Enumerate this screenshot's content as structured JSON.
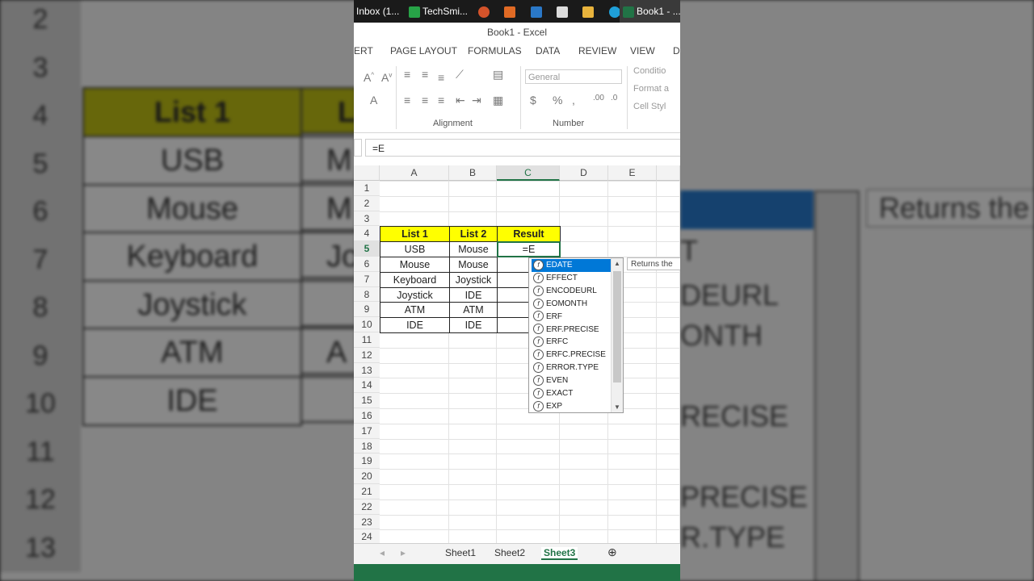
{
  "taskbar": {
    "items": [
      {
        "label": "Inbox (1..."
      },
      {
        "label": "TechSmi..."
      },
      {
        "label": "Book1 - ..."
      }
    ]
  },
  "window": {
    "title": "Book1 - Excel"
  },
  "ribbon_tabs": [
    "ERT",
    "PAGE LAYOUT",
    "FORMULAS",
    "DATA",
    "REVIEW",
    "VIEW",
    "D"
  ],
  "ribbon": {
    "number_format": "General",
    "alignment_label": "Alignment",
    "number_label": "Number",
    "styles": [
      "Conditio",
      "Format a",
      "Cell Styl"
    ]
  },
  "formula_bar": {
    "value": "=E"
  },
  "grid": {
    "columns": [
      "A",
      "B",
      "C",
      "D",
      "E",
      ""
    ],
    "selected_column": "C",
    "rows": [
      "1",
      "2",
      "3",
      "4",
      "5",
      "6",
      "7",
      "8",
      "9",
      "10",
      "11",
      "12",
      "13",
      "14",
      "15",
      "16",
      "17",
      "18",
      "19",
      "20",
      "21",
      "22",
      "23",
      "24"
    ],
    "selected_row": "5",
    "table": {
      "headers": [
        "List 1",
        "List 2",
        "Result"
      ],
      "rows": [
        [
          "USB",
          "Mouse",
          "=E"
        ],
        [
          "Mouse",
          "Mouse",
          ""
        ],
        [
          "Keyboard",
          "Joystick",
          ""
        ],
        [
          "Joystick",
          "IDE",
          ""
        ],
        [
          "ATM",
          "ATM",
          ""
        ],
        [
          "IDE",
          "IDE",
          ""
        ]
      ]
    }
  },
  "autocomplete": {
    "items": [
      "EDATE",
      "EFFECT",
      "ENCODEURL",
      "EOMONTH",
      "ERF",
      "ERF.PRECISE",
      "ERFC",
      "ERFC.PRECISE",
      "ERROR.TYPE",
      "EVEN",
      "EXACT",
      "EXP"
    ],
    "selected": "EDATE",
    "tooltip": "Returns the"
  },
  "sheet_tabs": [
    "Sheet1",
    "Sheet2",
    "Sheet3"
  ],
  "active_sheet": "Sheet3",
  "background": {
    "rows": [
      "2",
      "3",
      "4",
      "5",
      "6",
      "7",
      "8",
      "9",
      "10",
      "11",
      "12",
      "13"
    ],
    "list_header": "List 1",
    "partial_header": "L",
    "values": [
      "USB",
      "Mouse",
      "Keyboard",
      "Joystick",
      "ATM",
      "IDE"
    ],
    "col2_partial": [
      "M",
      "M",
      "Jo",
      "",
      "A",
      ""
    ],
    "right_list": [
      "E",
      "T",
      "DEURL",
      "ONTH",
      "",
      "RECISE",
      "",
      "PRECISE",
      "R.TYPE"
    ],
    "tooltip": "Returns the"
  }
}
